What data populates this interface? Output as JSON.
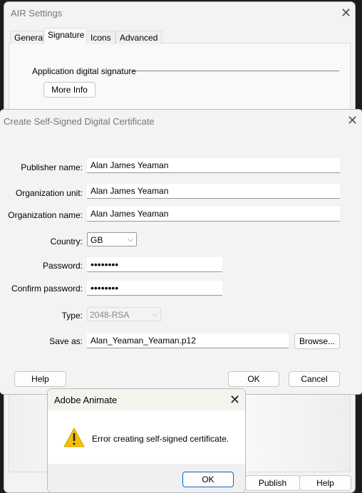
{
  "air": {
    "title": "AIR Settings",
    "tabs": [
      "General",
      "Signature",
      "Icons",
      "Advanced"
    ],
    "active_tab": "Signature",
    "section": "Application digital signature",
    "more_info": "More Info",
    "publish": "Publish",
    "help": "Help"
  },
  "cert": {
    "title": "Create Self-Signed Digital Certificate",
    "fields": {
      "publisher_label": "Publisher name:",
      "publisher": "Alan James Yeaman",
      "org_unit_label": "Organization unit:",
      "org_unit": "Alan James Yeaman",
      "org_name_label": "Organization name:",
      "org_name": "Alan James Yeaman",
      "country_label": "Country:",
      "country": "GB",
      "password_label": "Password:",
      "password": "••••••••",
      "confirm_label": "Confirm password:",
      "confirm": "••••••••",
      "type_label": "Type:",
      "type": "2048-RSA",
      "save_label": "Save as:",
      "save": "Alan_Yeaman_Yeaman.p12"
    },
    "browse": "Browse...",
    "help": "Help",
    "ok": "OK",
    "cancel": "Cancel"
  },
  "alert": {
    "title": "Adobe Animate",
    "message": "Error creating self-signed certificate.",
    "ok": "OK",
    "icon": "warning-icon"
  }
}
